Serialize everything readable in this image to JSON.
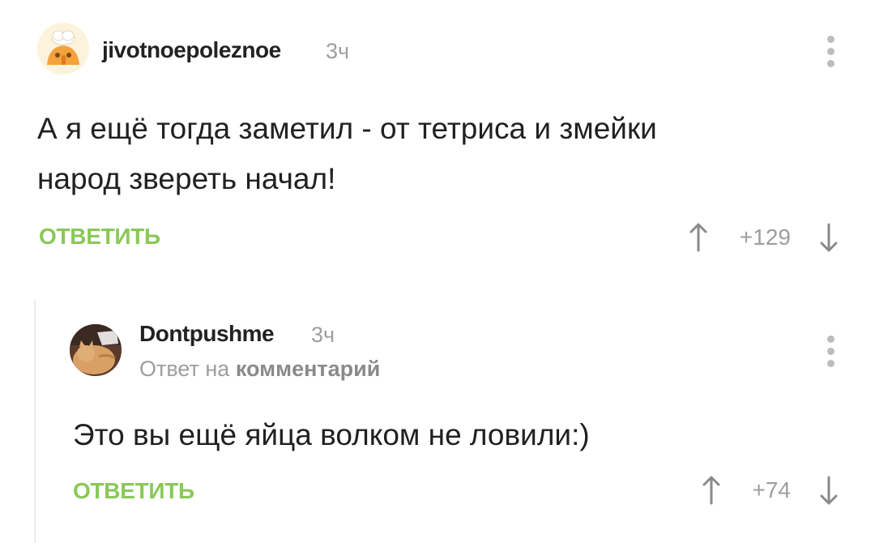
{
  "comments": [
    {
      "username": "jivotnoepoleznoe",
      "time": "3ч",
      "text_line1": "А я ещё тогда заметил - от тетриса и змейки",
      "text_line2": "народ звереть начал!",
      "reply_label": "ОТВЕТИТЬ",
      "score": "+129",
      "avatar_icon": "cartoon-chick-avatar"
    },
    {
      "username": "Dontpushme",
      "time": "3ч",
      "reply_to_prefix": "Ответ на",
      "reply_to_link": "комментарий",
      "text_line1": "Это вы ещё яйца волком не ловили:)",
      "reply_label": "ОТВЕТИТЬ",
      "score": "+74",
      "avatar_icon": "cat-photo-avatar"
    }
  ],
  "colors": {
    "accent_green": "#8ac858",
    "muted": "#9e9e9e",
    "text": "#212121"
  }
}
